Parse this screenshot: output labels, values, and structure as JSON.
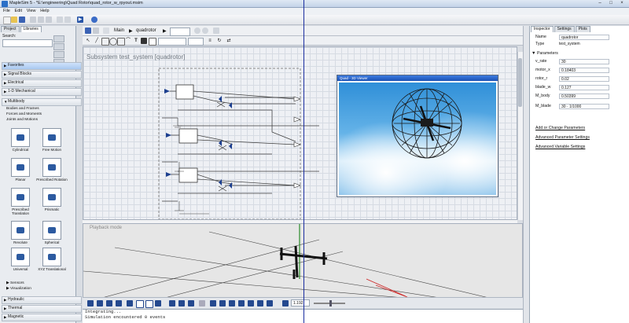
{
  "window": {
    "title": "MapleSim 5 - *E:\\engineering\\Quad Rotor\\quad_rotor_w_rpyout.msim"
  },
  "menu": [
    "File",
    "Edit",
    "View",
    "Help"
  ],
  "left_panel": {
    "tabs": [
      "Project",
      "Libraries"
    ],
    "search_label": "Search:",
    "categories": [
      {
        "label": "Favorites"
      },
      {
        "label": "Signal Blocks"
      },
      {
        "label": "Electrical"
      },
      {
        "label": "1-D Mechanical"
      },
      {
        "label": "Multibody"
      }
    ],
    "multibody_sub": [
      "Bodies and Frames",
      "Forces and Moments",
      "Joints and Motions"
    ],
    "components": [
      {
        "label": "Cylindrical"
      },
      {
        "label": "Free Motion"
      },
      {
        "label": "Planar"
      },
      {
        "label": "Prescribed Rotation"
      },
      {
        "label": "Prescribed Translation"
      },
      {
        "label": "Prismatic"
      },
      {
        "label": "Revolute"
      },
      {
        "label": "Spherical"
      },
      {
        "label": "Universal"
      },
      {
        "label": "XYZ Translational"
      }
    ],
    "extra_sub": [
      "Sensors",
      "Visualization"
    ],
    "bottom_categories": [
      "Hydraulic",
      "Thermal",
      "Magnetic"
    ]
  },
  "center": {
    "breadcrumb": [
      "Main",
      "quadrotor"
    ],
    "subsystem_title": "Subsystem test_system [quadrotor]",
    "inset_title": "Quad - 3D Viewer",
    "playback_label": "Playback mode",
    "time_value": "1.192",
    "console_lines": [
      "Integrating...",
      "Simulation encountered 0 events"
    ]
  },
  "right_panel": {
    "tabs": [
      "Inspector",
      "Settings",
      "Plots"
    ],
    "name_label": "Name",
    "name_value": "quadrotor",
    "type_label": "Type",
    "type_value": "test_system",
    "parameters_label": "Parameters",
    "params": [
      {
        "key": "v_rate",
        "value": "30"
      },
      {
        "key": "motor_x",
        "value": "0.18403"
      },
      {
        "key": "rotor_r",
        "value": "0.02"
      },
      {
        "key": "blade_w",
        "value": "0.127"
      },
      {
        "key": "M_body",
        "value": "0.50399"
      },
      {
        "key": "M_blade",
        "value": "30 · 1/1000"
      }
    ],
    "links": [
      "Add or Change Parameters",
      "Advanced Parameter Settings",
      "Advanced Variable Settings"
    ]
  }
}
